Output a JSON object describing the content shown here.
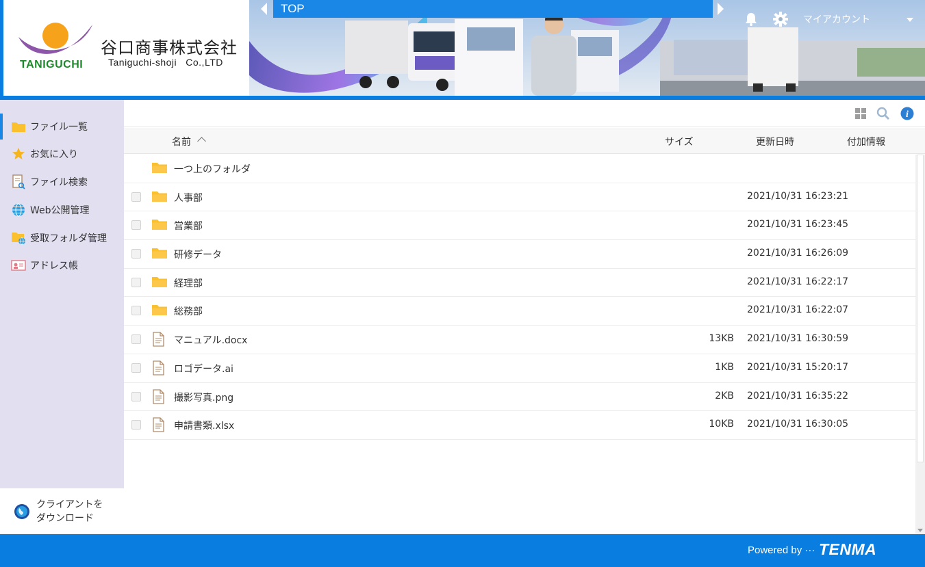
{
  "header": {
    "company_name_jp": "谷口商事株式会社",
    "company_name_en": "Taniguchi-shoji   Co.,LTD",
    "logo_mark_text": "TANIGUCHI",
    "breadcrumb": "TOP",
    "account_label": "マイアカウント",
    "icons": [
      "bell-icon",
      "gear-icon",
      "chevron-down-icon"
    ]
  },
  "sidebar": {
    "items": [
      {
        "label": "ファイル一覧",
        "icon": "folder-icon",
        "active": true
      },
      {
        "label": "お気に入り",
        "icon": "star-icon",
        "active": false
      },
      {
        "label": "ファイル検索",
        "icon": "file-search-icon",
        "active": false
      },
      {
        "label": "Web公開管理",
        "icon": "globe-icon",
        "active": false
      },
      {
        "label": "受取フォルダ管理",
        "icon": "folder-globe-icon",
        "active": false
      },
      {
        "label": "アドレス帳",
        "icon": "address-card-icon",
        "active": false
      }
    ],
    "download_line1": "クライアントを",
    "download_line2": "ダウンロード"
  },
  "toolbar": {
    "icons": [
      "grid-view-icon",
      "search-icon",
      "info-icon"
    ]
  },
  "columns": {
    "name": "名前",
    "size": "サイズ",
    "modified": "更新日時",
    "extra": "付加情報"
  },
  "files": [
    {
      "type": "parent",
      "name": "一つ上のフォルダ",
      "size": "",
      "modified": ""
    },
    {
      "type": "folder",
      "name": "人事部",
      "size": "",
      "modified": "2021/10/31 16:23:21"
    },
    {
      "type": "folder",
      "name": "営業部",
      "size": "",
      "modified": "2021/10/31 16:23:45"
    },
    {
      "type": "folder",
      "name": "研修データ",
      "size": "",
      "modified": "2021/10/31 16:26:09"
    },
    {
      "type": "folder",
      "name": "経理部",
      "size": "",
      "modified": "2021/10/31 16:22:17"
    },
    {
      "type": "folder",
      "name": "総務部",
      "size": "",
      "modified": "2021/10/31 16:22:07"
    },
    {
      "type": "file",
      "name": "マニュアル.docx",
      "size": "13KB",
      "modified": "2021/10/31 16:30:59"
    },
    {
      "type": "file",
      "name": "ロゴデータ.ai",
      "size": "1KB",
      "modified": "2021/10/31 15:20:17"
    },
    {
      "type": "file",
      "name": "撮影写真.png",
      "size": "2KB",
      "modified": "2021/10/31 16:35:22"
    },
    {
      "type": "file",
      "name": "申請書類.xlsx",
      "size": "10KB",
      "modified": "2021/10/31 16:30:05"
    }
  ],
  "footer": {
    "powered_by": "Powered by ···",
    "brand": "TENMA"
  },
  "colors": {
    "primary_blue": "#0a7de0",
    "sidebar_bg": "#e1dff0",
    "folder_yellow": "#fbc02d"
  }
}
